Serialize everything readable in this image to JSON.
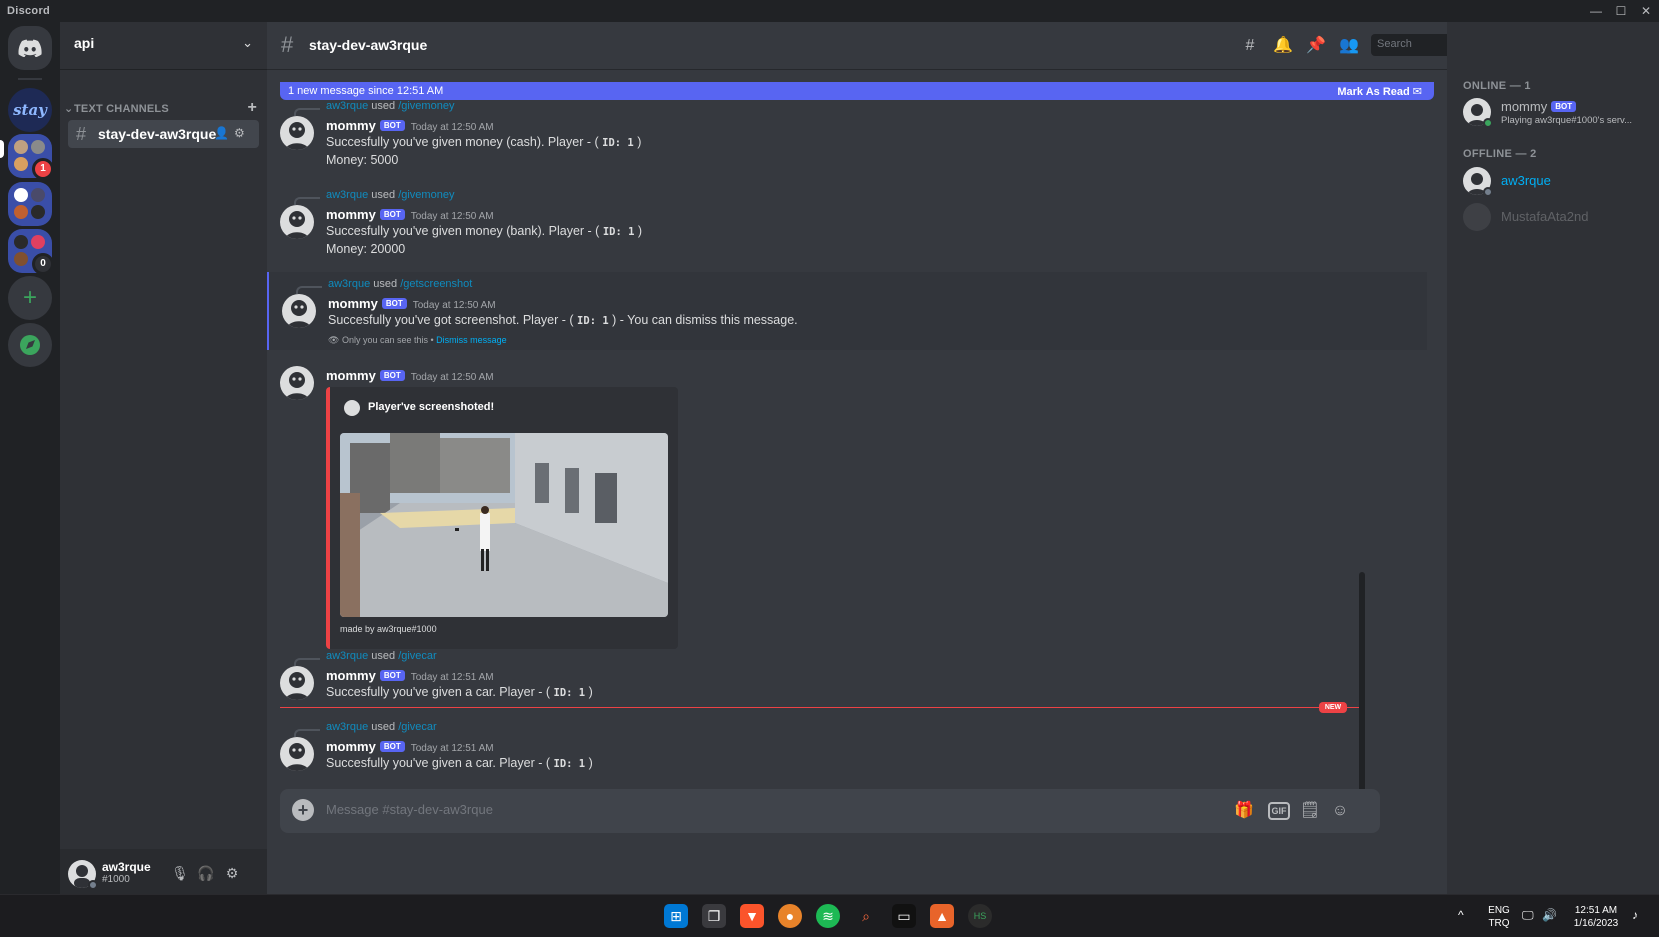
{
  "window": {
    "app_name": "Discord",
    "min": "—",
    "max": "☐",
    "close": "✕"
  },
  "guild": {
    "name": "api"
  },
  "sidebar": {
    "category": "TEXT CHANNELS",
    "channels": [
      {
        "label": "stay-dev-aw3rque"
      }
    ]
  },
  "user_panel": {
    "username": "aw3rque",
    "discriminator": "#1000"
  },
  "rail": {
    "badges": [
      "1",
      "0"
    ]
  },
  "chat": {
    "channel_name": "stay-dev-aw3rque",
    "search_placeholder": "Search",
    "new_bar": {
      "text": "1 new message since 12:51 AM",
      "mark": "Mark As Read"
    },
    "used_word": "used",
    "bot_badge": "BOT",
    "messages": [
      {
        "reply_user": "aw3rque",
        "reply_cmd": "/givemoney",
        "author": "mommy",
        "time": "Today at 12:50 AM",
        "line1": "Succesfully you've given money (cash). Player - (",
        "code": "ID: 1",
        "line1_end": ")",
        "line2": "Money: 5000"
      },
      {
        "reply_user": "aw3rque",
        "reply_cmd": "/givemoney",
        "author": "mommy",
        "time": "Today at 12:50 AM",
        "line1": "Succesfully you've given money (bank). Player - (",
        "code": "ID: 1",
        "line1_end": ")",
        "line2": "Money: 20000"
      },
      {
        "reply_user": "aw3rque",
        "reply_cmd": "/getscreenshot",
        "author": "mommy",
        "time": "Today at 12:50 AM",
        "line1": "Succesfully you've got screenshot. Player - (",
        "code": "ID: 1",
        "line1_end": ") - You can dismiss this message.",
        "ephemeral": "Only you can see this • ",
        "dismiss": "Dismiss message"
      },
      {
        "author": "mommy",
        "time": "Today at 12:50 AM",
        "embed_title": "Player've screenshoted!",
        "embed_footer": "made by aw3rque#1000"
      },
      {
        "reply_user": "aw3rque",
        "reply_cmd": "/givecar",
        "author": "mommy",
        "time": "Today at 12:51 AM",
        "line1": "Succesfully you've given a car. Player - (",
        "code": "ID: 1",
        "line1_end": ")"
      },
      {
        "reply_user": "aw3rque",
        "reply_cmd": "/givecar",
        "author": "mommy",
        "time": "Today at 12:51 AM",
        "line1": "Succesfully you've given a car. Player - (",
        "code": "ID: 1",
        "line1_end": ")"
      }
    ],
    "new_divider": "NEW",
    "composer_placeholder": "Message #stay-dev-aw3rque"
  },
  "members": {
    "online_header": "ONLINE — 1",
    "offline_header": "OFFLINE — 2",
    "online": [
      {
        "name": "mommy",
        "activity": "Playing aw3rque#1000's serv..."
      }
    ],
    "offline": [
      {
        "name": "aw3rque"
      },
      {
        "name": "MustafaAta2nd"
      }
    ]
  },
  "taskbar": {
    "lang1": "ENG",
    "lang2": "TRQ",
    "time": "12:51 AM",
    "date": "1/16/2023",
    "chevron": "^"
  },
  "colors": {
    "blurple": "#5865f2",
    "red": "#ed4245",
    "green": "#3ba55d",
    "bg": "#36393f"
  }
}
